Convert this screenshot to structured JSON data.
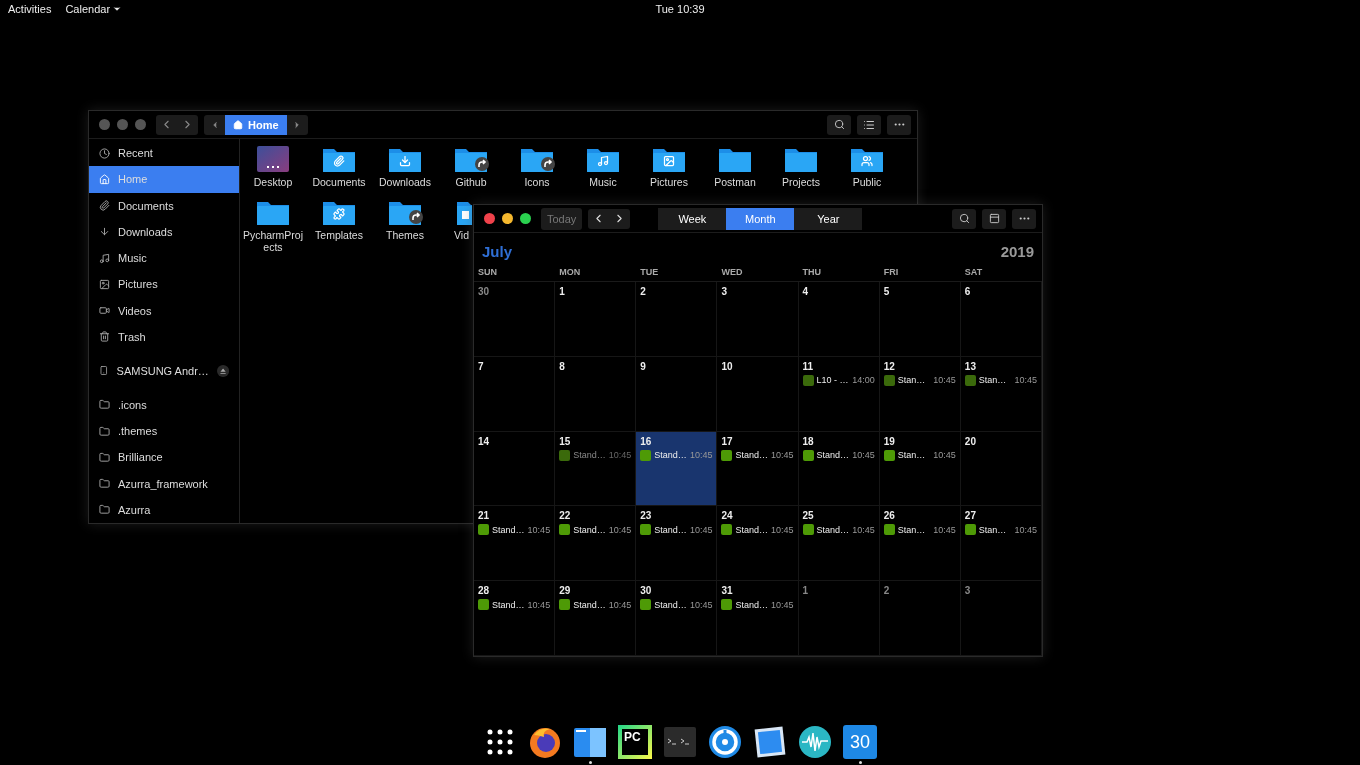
{
  "top_bar": {
    "activities": "Activities",
    "app_menu": "Calendar",
    "clock": "Tue 10:39"
  },
  "files_window": {
    "path": [
      {
        "label": "Home",
        "selected": true
      }
    ],
    "sidebar": {
      "places": [
        {
          "label": "Recent",
          "selected": false
        },
        {
          "label": "Home",
          "selected": true
        },
        {
          "label": "Documents",
          "selected": false
        },
        {
          "label": "Downloads",
          "selected": false
        },
        {
          "label": "Music",
          "selected": false
        },
        {
          "label": "Pictures",
          "selected": false
        },
        {
          "label": "Videos",
          "selected": false
        },
        {
          "label": "Trash",
          "selected": false
        }
      ],
      "devices": [
        {
          "label": "SAMSUNG Andr…",
          "selected": false
        }
      ],
      "bookmarks": [
        {
          "label": ".icons",
          "selected": false
        },
        {
          "label": ".themes",
          "selected": false
        },
        {
          "label": "Brilliance",
          "selected": false
        },
        {
          "label": "Azurra_framework",
          "selected": false
        },
        {
          "label": "Azurra",
          "selected": false
        }
      ]
    },
    "items": [
      {
        "kind": "desktop",
        "label": "Desktop",
        "link": false
      },
      {
        "kind": "folder",
        "label": "Documents",
        "link": false
      },
      {
        "kind": "folder",
        "label": "Downloads",
        "link": false
      },
      {
        "kind": "folder",
        "label": "Github",
        "link": true
      },
      {
        "kind": "folder",
        "label": "Icons",
        "link": true
      },
      {
        "kind": "folder",
        "label": "Music",
        "link": false
      },
      {
        "kind": "folder",
        "label": "Pictures",
        "link": false
      },
      {
        "kind": "folder",
        "label": "Postman",
        "link": false
      },
      {
        "kind": "folder",
        "label": "Projects",
        "link": false
      },
      {
        "kind": "folder",
        "label": "Public",
        "link": false
      },
      {
        "kind": "folder",
        "label": "PycharmProjects",
        "link": false
      },
      {
        "kind": "folder",
        "label": "Templates",
        "link": false
      },
      {
        "kind": "folder",
        "label": "Themes",
        "link": true
      },
      {
        "kind": "partial",
        "label": "Vid"
      }
    ]
  },
  "calendar_window": {
    "today": "Today",
    "views": [
      {
        "label": "Week",
        "selected": false
      },
      {
        "label": "Month",
        "selected": true
      },
      {
        "label": "Year",
        "selected": false
      }
    ],
    "month": "July",
    "year": "2019",
    "weekdays": [
      "SUN",
      "MON",
      "TUE",
      "WED",
      "THU",
      "FRI",
      "SAT"
    ],
    "weeks": [
      [
        {
          "day": "30",
          "other_month": true,
          "selected": false
        },
        {
          "day": "1",
          "other_month": false,
          "selected": false
        },
        {
          "day": "2",
          "other_month": false,
          "selected": false
        },
        {
          "day": "3",
          "other_month": false,
          "selected": false
        },
        {
          "day": "4",
          "other_month": false,
          "selected": false
        },
        {
          "day": "5",
          "other_month": false,
          "selected": false
        },
        {
          "day": "6",
          "other_month": false,
          "selected": false
        }
      ],
      [
        {
          "day": "7",
          "other_month": false,
          "selected": false
        },
        {
          "day": "8",
          "other_month": false,
          "selected": false
        },
        {
          "day": "9",
          "other_month": false,
          "selected": false
        },
        {
          "day": "10",
          "other_month": false,
          "selected": false
        },
        {
          "day": "11",
          "other_month": false,
          "selected": false,
          "events": [
            {
              "title": "L10 - …",
              "time": "14:00",
              "color": "#3b6a0b",
              "dimmed": false
            }
          ]
        },
        {
          "day": "12",
          "other_month": false,
          "selected": false,
          "events": [
            {
              "title": "Stan…",
              "time": "10:45",
              "color": "#3b6a0b",
              "dimmed": false
            }
          ]
        },
        {
          "day": "13",
          "other_month": false,
          "selected": false,
          "events": [
            {
              "title": "Stan…",
              "time": "10:45",
              "color": "#3b6a0b",
              "dimmed": false
            }
          ]
        }
      ],
      [
        {
          "day": "14",
          "other_month": false,
          "selected": false
        },
        {
          "day": "15",
          "other_month": false,
          "selected": false,
          "events": [
            {
              "title": "Stand…",
              "time": "10:45",
              "color": "#3b6a0b",
              "dimmed": true
            }
          ]
        },
        {
          "day": "16",
          "other_month": false,
          "selected": true,
          "events": [
            {
              "title": "Stand…",
              "time": "10:45",
              "color": "#4e9a06",
              "dimmed": false
            }
          ]
        },
        {
          "day": "17",
          "other_month": false,
          "selected": false,
          "events": [
            {
              "title": "Stand…",
              "time": "10:45",
              "color": "#4e9a06",
              "dimmed": false
            }
          ]
        },
        {
          "day": "18",
          "other_month": false,
          "selected": false,
          "events": [
            {
              "title": "Stand…",
              "time": "10:45",
              "color": "#4e9a06",
              "dimmed": false
            }
          ]
        },
        {
          "day": "19",
          "other_month": false,
          "selected": false,
          "events": [
            {
              "title": "Stan…",
              "time": "10:45",
              "color": "#4e9a06",
              "dimmed": false
            }
          ]
        },
        {
          "day": "20",
          "other_month": false,
          "selected": false
        }
      ],
      [
        {
          "day": "21",
          "other_month": false,
          "selected": false,
          "events": [
            {
              "title": "Stand…",
              "time": "10:45",
              "color": "#4e9a06",
              "dimmed": false
            }
          ]
        },
        {
          "day": "22",
          "other_month": false,
          "selected": false,
          "events": [
            {
              "title": "Stand…",
              "time": "10:45",
              "color": "#4e9a06",
              "dimmed": false
            }
          ]
        },
        {
          "day": "23",
          "other_month": false,
          "selected": false,
          "events": [
            {
              "title": "Stand…",
              "time": "10:45",
              "color": "#4e9a06",
              "dimmed": false
            }
          ]
        },
        {
          "day": "24",
          "other_month": false,
          "selected": false,
          "events": [
            {
              "title": "Stand…",
              "time": "10:45",
              "color": "#4e9a06",
              "dimmed": false
            }
          ]
        },
        {
          "day": "25",
          "other_month": false,
          "selected": false,
          "events": [
            {
              "title": "Stand…",
              "time": "10:45",
              "color": "#4e9a06",
              "dimmed": false
            }
          ]
        },
        {
          "day": "26",
          "other_month": false,
          "selected": false,
          "events": [
            {
              "title": "Stan…",
              "time": "10:45",
              "color": "#4e9a06",
              "dimmed": false
            }
          ]
        },
        {
          "day": "27",
          "other_month": false,
          "selected": false,
          "events": [
            {
              "title": "Stan…",
              "time": "10:45",
              "color": "#4e9a06",
              "dimmed": false
            }
          ]
        }
      ],
      [
        {
          "day": "28",
          "other_month": false,
          "selected": false,
          "events": [
            {
              "title": "Stand…",
              "time": "10:45",
              "color": "#4e9a06",
              "dimmed": false
            }
          ]
        },
        {
          "day": "29",
          "other_month": false,
          "selected": false,
          "events": [
            {
              "title": "Stand…",
              "time": "10:45",
              "color": "#4e9a06",
              "dimmed": false
            }
          ]
        },
        {
          "day": "30",
          "other_month": false,
          "selected": false,
          "events": [
            {
              "title": "Stand…",
              "time": "10:45",
              "color": "#4e9a06",
              "dimmed": false
            }
          ]
        },
        {
          "day": "31",
          "other_month": false,
          "selected": false,
          "events": [
            {
              "title": "Stand…",
              "time": "10:45",
              "color": "#4e9a06",
              "dimmed": false
            }
          ]
        },
        {
          "day": "1",
          "other_month": true,
          "selected": false
        },
        {
          "day": "2",
          "other_month": true,
          "selected": false
        },
        {
          "day": "3",
          "other_month": true,
          "selected": false
        }
      ]
    ]
  },
  "dock": [
    {
      "kind": "grid",
      "running": false
    },
    {
      "kind": "globe",
      "running": false
    },
    {
      "kind": "files",
      "running": true
    },
    {
      "kind": "ide",
      "label": "PC",
      "running": false
    },
    {
      "kind": "terminal",
      "running": false
    },
    {
      "kind": "dial",
      "running": false
    },
    {
      "kind": "stamp",
      "running": false
    },
    {
      "kind": "wave",
      "running": false
    },
    {
      "kind": "calendar",
      "label": "30",
      "running": true
    }
  ]
}
